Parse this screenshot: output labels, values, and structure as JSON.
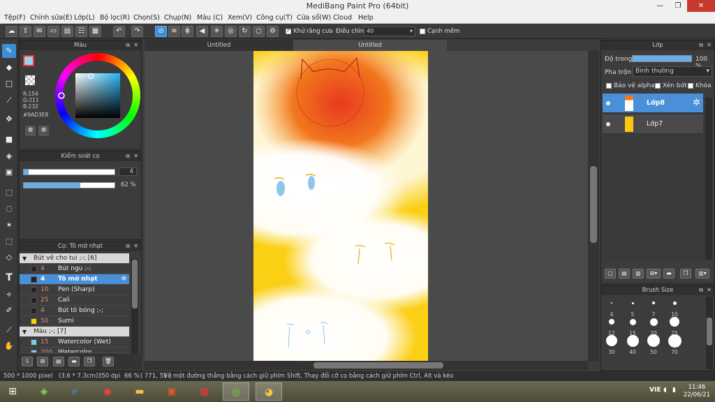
{
  "window": {
    "title": "MediBang Paint Pro (64bit)"
  },
  "menu": [
    "Tệp(F)",
    "Chỉnh sửa(E)",
    "Lớp(L)",
    "Bộ lọc(R)",
    "Chọn(S)",
    "Chụp(N)",
    "Màu (C)",
    "Xem(V)",
    "Công cụ(T)",
    "Cửa sổ(W)",
    "Cloud",
    "Help"
  ],
  "toolbar": {
    "antialias_label": "Khử răng cưa",
    "adjust_label": "Điều chỉnh",
    "adjust_value": "40",
    "edge_label": "Cạnh mềm"
  },
  "tabs": [
    "Untitled",
    "Untitled"
  ],
  "color_panel": {
    "title": "Màu",
    "r": "R:154",
    "g": "G:211",
    "b": "B:232",
    "hex": "#9AD3E8",
    "current_color": "#9AD3E8"
  },
  "brush_control": {
    "title": "Kiểm soát cọ",
    "size_value": "4",
    "size_fraction": 0.05,
    "opacity_value": "62",
    "opacity_unit": "%",
    "opacity_fraction": 0.62
  },
  "brush_panel": {
    "title": "Cọ: Tô mờ nhạt",
    "rows": [
      {
        "type": "group",
        "arrow": "▼",
        "name": "Bút vẽ cho tui ;-; [6]"
      },
      {
        "type": "item",
        "size": "4",
        "name": "Bút ngu ;-;",
        "color": "#222222"
      },
      {
        "type": "sel",
        "size": "4",
        "name": "Tô mờ nhạt",
        "color": "#222222"
      },
      {
        "type": "item",
        "size": "10",
        "name": "Pen (Sharp)",
        "color": "#222222"
      },
      {
        "type": "item",
        "size": "25",
        "name": "Cali",
        "color": "#222222"
      },
      {
        "type": "item",
        "size": "4",
        "name": "Bút tô bóng ;-;",
        "color": "#222222"
      },
      {
        "type": "item",
        "size": "50",
        "name": "Sumi",
        "color": "#f5d400"
      },
      {
        "type": "group",
        "arrow": "▼",
        "name": "Màu ;-; [7]"
      },
      {
        "type": "item",
        "size": "15",
        "name": "Watercolor (Wet)",
        "color": "#7ec8ec"
      },
      {
        "type": "item",
        "size": "200",
        "name": "Watercolor",
        "color": "#7ec8ec"
      }
    ]
  },
  "layer_panel": {
    "title": "Lớp",
    "opacity_label": "Độ trong",
    "opacity_value": "100 %",
    "blend_label": "Pha trộn",
    "blend_value": "Bình thường",
    "protect_alpha": "Bảo vệ alpha",
    "clipping": "Xén bớt",
    "lock": "Khóa",
    "layers": [
      {
        "name": "Lớp8",
        "selected": true
      },
      {
        "name": "Lớp7",
        "selected": false
      }
    ]
  },
  "brush_size_panel": {
    "title": "Brush Size",
    "sizes": [
      "4",
      "5",
      "7",
      "10",
      "12",
      "15",
      "20",
      "25",
      "30",
      "40",
      "50",
      "70"
    ]
  },
  "status": {
    "dimensions": "500 * 1000 pixel",
    "cm": "(3.6 * 7.3cm)",
    "dpi": "350 dpi",
    "zoom": "66 %",
    "cursor": "( 771, 51 )",
    "hint": "Vẽ một đường thẳng bằng cách giữ phím Shift, Thay đổi cỡ cọ bằng cách giữ phím Ctrl, Alt và kéo"
  },
  "taskbar": {
    "lang": "VIE",
    "time": "11:46",
    "date": "22/06/21"
  }
}
